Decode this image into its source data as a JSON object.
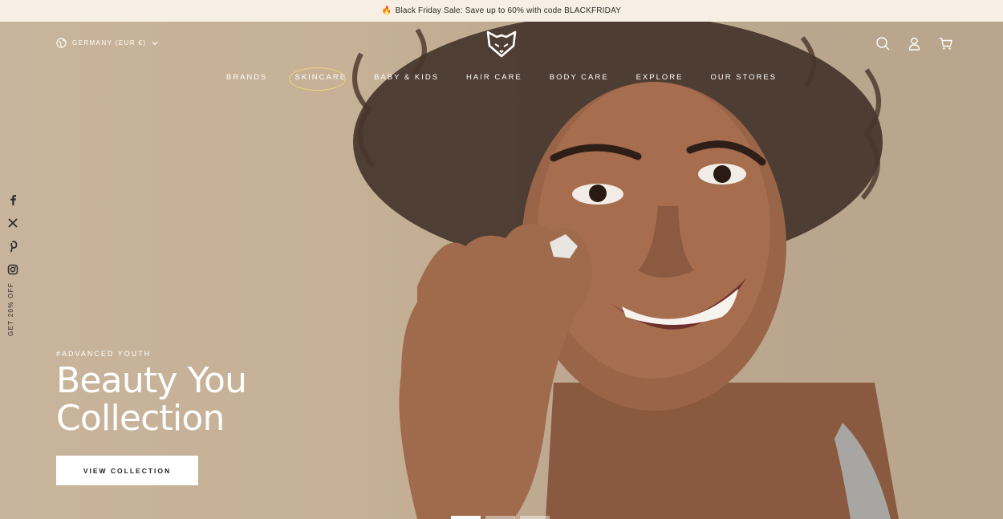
{
  "announcement": {
    "icon": "fire-icon",
    "text": "Black Friday Sale: Save up to 60% with code BLACKFRIDAY"
  },
  "header": {
    "locale": "GERMANY (EUR €)",
    "logo": "fox-logo",
    "icons": [
      "search-icon",
      "account-icon",
      "cart-icon"
    ]
  },
  "nav": {
    "items": [
      "BRANDS",
      "SKINCARE",
      "BABY & KIDS",
      "HAIR CARE",
      "BODY CARE",
      "EXPLORE",
      "OUR STORES"
    ]
  },
  "socials": {
    "icons": [
      "facebook-icon",
      "x-icon",
      "pinterest-icon",
      "instagram-icon"
    ],
    "promo": "GET 20% OFF"
  },
  "hero": {
    "tag": "#ADVANCED YOUTH",
    "headline_line1": "Beauty You",
    "headline_line2": "Collection",
    "cta": "VIEW COLLECTION",
    "slide_count": 3,
    "active_slide": 1
  },
  "colors": {
    "announcement_bg": "#f7efe3",
    "hero_bg": "#c8b49c",
    "highlight_ring": "#f0d37a"
  }
}
